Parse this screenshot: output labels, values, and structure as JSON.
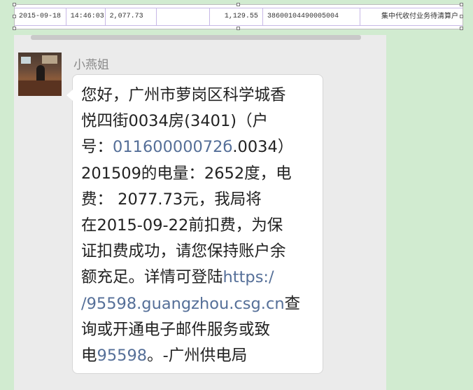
{
  "sheet": {
    "date": "2015-09-18",
    "time": "14:46:03",
    "amount": "2,077.73",
    "amount2": "1,129.55",
    "account": "38600104490005004",
    "description": "集中代收付业务待清算户"
  },
  "chat": {
    "sender": "小燕姐",
    "message": {
      "l1": "您好，广州市萝岗区科学城香",
      "l2": "悦四街0034房(3401)（户",
      "l3a": "号：",
      "l3_link": "01160000072б",
      "l3b": ".0034）",
      "l4": "201509的电量：2652度，电",
      "l5": "费：  2077.73元，我局将",
      "l6": "在2015-09-22前扣费，为保",
      "l7": "证扣费成功，请您保持账户余",
      "l8a": "额充足。详情可登陆",
      "l8_link": "https:/",
      "l9_link": "/95598.guangzhou.csg.cn",
      "l9b": "查",
      "l10": "询或开通电子邮件服务或致",
      "l11a": "电",
      "l11_link": "95598",
      "l11b": "。-广州供电局"
    }
  },
  "colors": {
    "background": "#d1ebd0",
    "chat_panel": "#ebebeb",
    "link": "#556f98",
    "bubble": "#ffffff"
  }
}
